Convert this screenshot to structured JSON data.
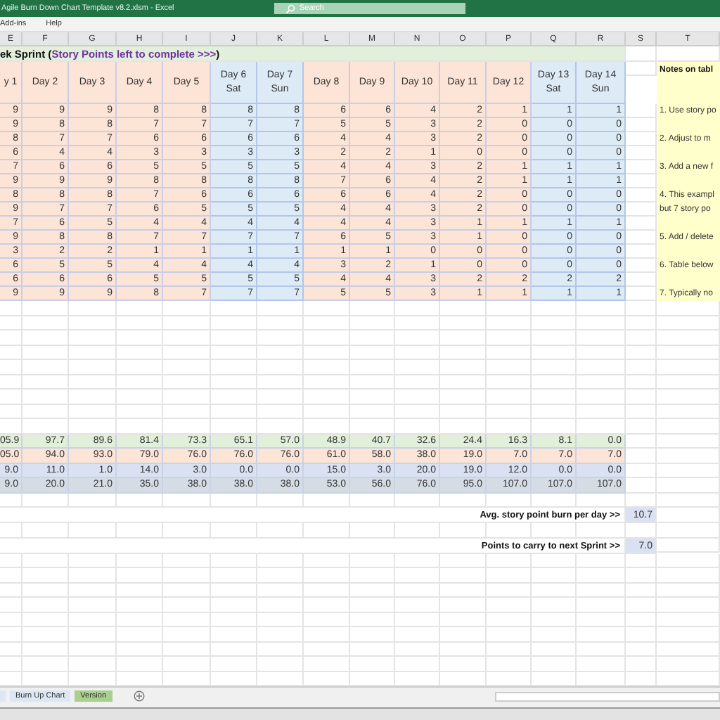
{
  "window": {
    "title": "Agile Burn Down Chart Template v8.2.xlsm  -  Excel",
    "search_placeholder": "Search"
  },
  "menu": [
    "Add-ins",
    "Help"
  ],
  "column_letters": [
    "E",
    "F",
    "G",
    "H",
    "I",
    "J",
    "K",
    "L",
    "M",
    "N",
    "O",
    "P",
    "Q",
    "R",
    "S",
    "T"
  ],
  "sheet_title": {
    "prefix": "ek Sprint (",
    "highlight": "Story Points left to complete >>>",
    "suffix": ")"
  },
  "days": [
    {
      "label": "y 1",
      "weekend": false
    },
    {
      "label": "Day 2",
      "weekend": false
    },
    {
      "label": "Day 3",
      "weekend": false
    },
    {
      "label": "Day 4",
      "weekend": false
    },
    {
      "label": "Day 5",
      "weekend": false
    },
    {
      "label": "Day 6",
      "sub": "Sat",
      "weekend": true
    },
    {
      "label": "Day 7",
      "sub": "Sun",
      "weekend": true
    },
    {
      "label": "Day 8",
      "weekend": false
    },
    {
      "label": "Day 9",
      "weekend": false
    },
    {
      "label": "Day 10",
      "weekend": false
    },
    {
      "label": "Day 11",
      "weekend": false
    },
    {
      "label": "Day 12",
      "weekend": false
    },
    {
      "label": "Day 13",
      "sub": "Sat",
      "weekend": true
    },
    {
      "label": "Day 14",
      "sub": "Sun",
      "weekend": true
    }
  ],
  "rows": [
    [
      "9",
      "9",
      "9",
      "8",
      "8",
      "8",
      "8",
      "6",
      "6",
      "4",
      "2",
      "1",
      "1",
      "1"
    ],
    [
      "9",
      "8",
      "8",
      "7",
      "7",
      "7",
      "7",
      "5",
      "5",
      "3",
      "2",
      "0",
      "0",
      "0"
    ],
    [
      "8",
      "7",
      "7",
      "6",
      "6",
      "6",
      "6",
      "4",
      "4",
      "3",
      "2",
      "0",
      "0",
      "0"
    ],
    [
      "6",
      "4",
      "4",
      "3",
      "3",
      "3",
      "3",
      "2",
      "2",
      "1",
      "0",
      "0",
      "0",
      "0"
    ],
    [
      "7",
      "6",
      "6",
      "5",
      "5",
      "5",
      "5",
      "4",
      "4",
      "3",
      "2",
      "1",
      "1",
      "1"
    ],
    [
      "9",
      "9",
      "9",
      "8",
      "8",
      "8",
      "8",
      "7",
      "6",
      "4",
      "2",
      "1",
      "1",
      "1"
    ],
    [
      "8",
      "8",
      "8",
      "7",
      "6",
      "6",
      "6",
      "6",
      "6",
      "4",
      "2",
      "0",
      "0",
      "0"
    ],
    [
      "9",
      "7",
      "7",
      "6",
      "5",
      "5",
      "5",
      "4",
      "4",
      "3",
      "2",
      "0",
      "0",
      "0"
    ],
    [
      "7",
      "6",
      "5",
      "4",
      "4",
      "4",
      "4",
      "4",
      "4",
      "3",
      "1",
      "1",
      "1",
      "1"
    ],
    [
      "9",
      "8",
      "8",
      "7",
      "7",
      "7",
      "7",
      "6",
      "5",
      "3",
      "1",
      "0",
      "0",
      "0"
    ],
    [
      "3",
      "2",
      "2",
      "1",
      "1",
      "1",
      "1",
      "1",
      "1",
      "0",
      "0",
      "0",
      "0",
      "0"
    ],
    [
      "6",
      "5",
      "5",
      "4",
      "4",
      "4",
      "4",
      "3",
      "2",
      "1",
      "0",
      "0",
      "0",
      "0"
    ],
    [
      "6",
      "6",
      "6",
      "5",
      "5",
      "5",
      "5",
      "4",
      "4",
      "3",
      "2",
      "2",
      "2",
      "2"
    ],
    [
      "9",
      "9",
      "9",
      "8",
      "7",
      "7",
      "7",
      "5",
      "5",
      "3",
      "1",
      "1",
      "1",
      "1"
    ]
  ],
  "notes": {
    "title": "Notes on tabl",
    "lines": [
      "1. Use story po",
      "2. Adjust to m",
      "3. Add a new f",
      "4. This exampl",
      "but 7 story po",
      "5. Add / delete",
      "6. Table below",
      "7. Typically no"
    ]
  },
  "summary_rows": [
    {
      "color": "#e2efda",
      "values": [
        "05.9",
        "97.7",
        "89.6",
        "81.4",
        "73.3",
        "65.1",
        "57.0",
        "48.9",
        "40.7",
        "32.6",
        "24.4",
        "16.3",
        "8.1",
        "0.0"
      ]
    },
    {
      "color": "#fce4d6",
      "values": [
        "05.0",
        "94.0",
        "93.0",
        "79.0",
        "76.0",
        "76.0",
        "76.0",
        "61.0",
        "58.0",
        "38.0",
        "19.0",
        "7.0",
        "7.0",
        "7.0"
      ]
    },
    {
      "color": "#d9e1f2",
      "values": [
        "9.0",
        "11.0",
        "1.0",
        "14.0",
        "3.0",
        "0.0",
        "0.0",
        "15.0",
        "3.0",
        "20.0",
        "19.0",
        "12.0",
        "0.0",
        "0.0"
      ]
    },
    {
      "color": "#d6dce4",
      "values": [
        "9.0",
        "20.0",
        "21.0",
        "35.0",
        "38.0",
        "38.0",
        "38.0",
        "53.0",
        "56.0",
        "76.0",
        "95.0",
        "107.0",
        "107.0",
        "107.0"
      ]
    }
  ],
  "stats": [
    {
      "label": "Avg. story point burn per day >>",
      "value": "10.7"
    },
    {
      "label": "Points to carry to next Sprint >>",
      "value": "7.0"
    }
  ],
  "sheet_tabs": [
    {
      "label": "Burn Up Chart",
      "selected": false,
      "color": "#dde7f3"
    },
    {
      "label": "Version",
      "selected": false,
      "color": "#a9d08e"
    }
  ]
}
